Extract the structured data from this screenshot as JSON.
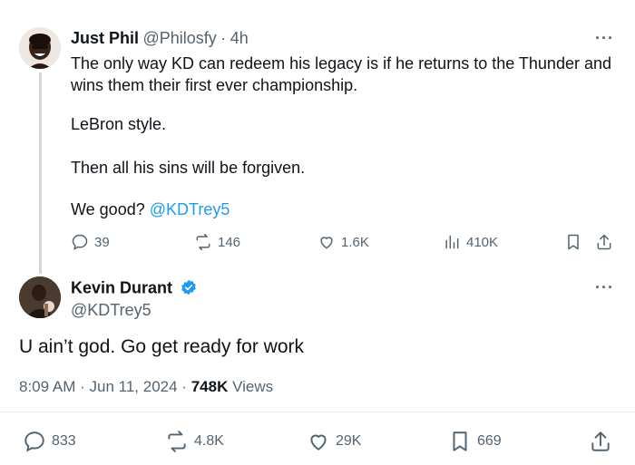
{
  "reply_tweet": {
    "author_name": "Just Phil",
    "handle": "@Philosfy",
    "separator": "·",
    "time_ago": "4h",
    "more": "···",
    "text_lines": [
      "The only way KD can redeem his legacy is if he returns to the Thunder and",
      "wins them their first ever championship."
    ],
    "para2": "LeBron style.",
    "para3": "Then all his sins will be forgiven.",
    "para4_text": "We good?",
    "mention": "@KDTrey5",
    "actions": {
      "replies": "39",
      "reposts": "146",
      "likes": "1.6K",
      "views": "410K"
    }
  },
  "main_tweet": {
    "author_name": "Kevin Durant",
    "handle": "@KDTrey5",
    "more": "···",
    "text": "U ain’t god. Go get ready for work",
    "time": "8:09 AM",
    "date": "Jun 11, 2024",
    "separator": "·",
    "views_count": "748K",
    "views_label": "Views",
    "actions": {
      "replies": "833",
      "reposts": "4.8K",
      "likes": "29K",
      "bookmarks": "669"
    }
  },
  "colors": {
    "accent": "#1d9bf0",
    "secondary_text": "#536471",
    "primary_text": "#0f1419"
  }
}
